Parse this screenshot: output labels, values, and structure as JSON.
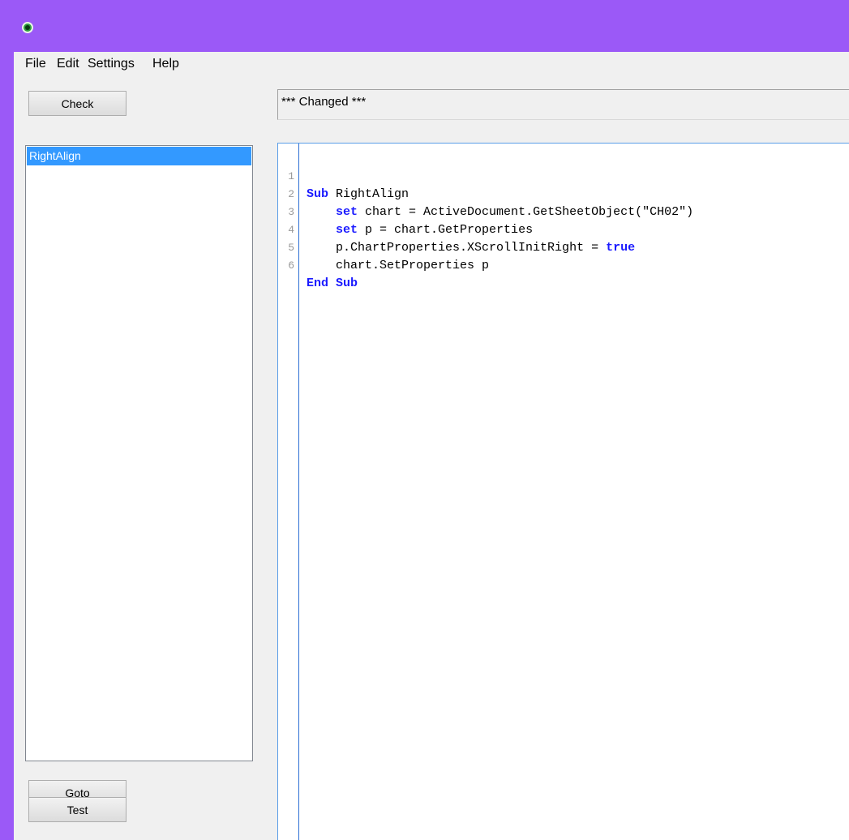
{
  "window": {
    "icon": "qlikview-icon"
  },
  "menu": {
    "items": [
      "File",
      "Edit",
      "Settings",
      "Help"
    ]
  },
  "buttons": {
    "check": "Check",
    "goto": "Goto",
    "test": "Test"
  },
  "status": {
    "text": "*** Changed ***"
  },
  "macro_list": {
    "items": [
      "RightAlign"
    ],
    "selected": "RightAlign"
  },
  "editor": {
    "line_numbers": [
      "1",
      "2",
      "3",
      "4",
      "5",
      "6"
    ],
    "lines": [
      {
        "indent": "",
        "kw": "Sub",
        "rest": " RightAlign",
        "tail_kw": ""
      },
      {
        "indent": "    ",
        "kw": "set",
        "rest": " chart = ActiveDocument.GetSheetObject(\"CH02\")",
        "tail_kw": ""
      },
      {
        "indent": "    ",
        "kw": "set",
        "rest": " p = chart.GetProperties",
        "tail_kw": ""
      },
      {
        "indent": "    ",
        "kw": "",
        "rest": "p.ChartProperties.XScrollInitRight = ",
        "tail_kw": "true"
      },
      {
        "indent": "    ",
        "kw": "",
        "rest": "chart.SetProperties p",
        "tail_kw": ""
      },
      {
        "indent": "",
        "kw": "End Sub",
        "rest": "",
        "tail_kw": ""
      }
    ]
  },
  "colors": {
    "titlebar": "#9b59f7",
    "keyword": "#1a1aff",
    "selection": "#3399ff"
  }
}
